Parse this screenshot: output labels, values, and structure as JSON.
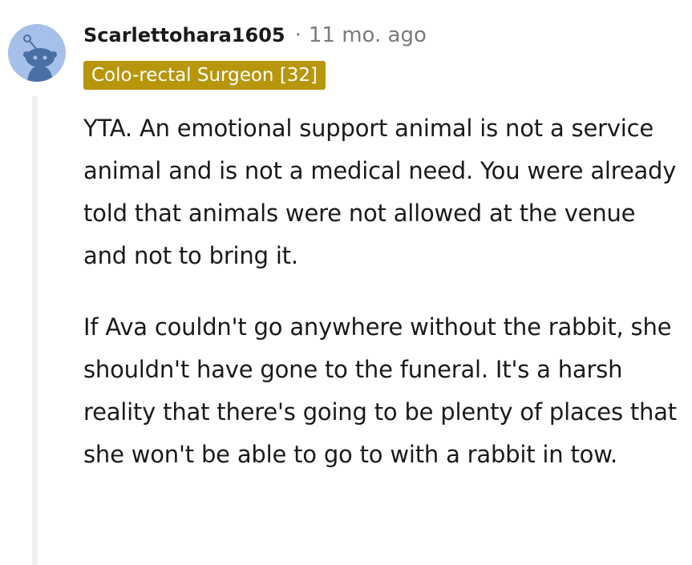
{
  "comment": {
    "username": "Scarlettohara1605",
    "separator": "·",
    "timestamp": "11 mo. ago",
    "flair": "Colo-rectal Surgeon [32]",
    "paragraphs": [
      "YTA. An emotional support animal is not a service animal and is not a medical need. You were already told that animals were not allowed at the venue and not to bring it.",
      "If Ava couldn't go anywhere without the rabbit, she shouldn't have gone to the funeral. It's a harsh reality that there's going to be plenty of places that she won't be able to go to with a rabbit in tow."
    ]
  },
  "colors": {
    "avatar_background": "#a6c0ea",
    "avatar_figure": "#4a6fa5",
    "flair_background": "#b8960c",
    "flair_text": "#ffffff",
    "metadata_text": "#787c7e",
    "body_text": "#1a1a1b",
    "thread_line": "#edeff1"
  },
  "icons": {
    "avatar": "reddit-snoo-avatar-icon"
  }
}
